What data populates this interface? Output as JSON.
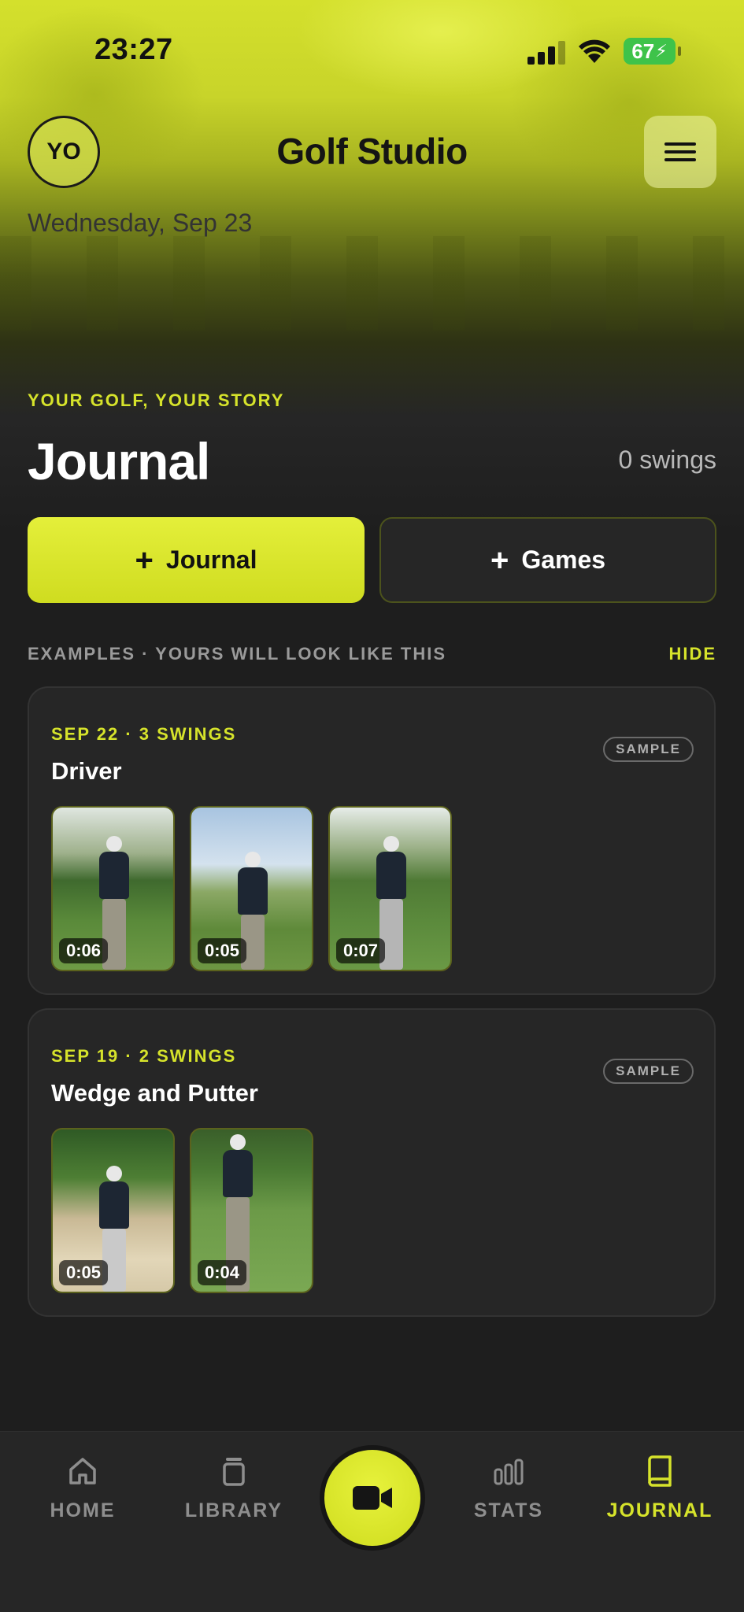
{
  "status_bar": {
    "time": "23:27",
    "battery": "67"
  },
  "header": {
    "avatar_initials": "YO",
    "app_title": "Golf Studio",
    "date": "Wednesday, Sep 23"
  },
  "hero": {
    "eyebrow": "YOUR GOLF, YOUR STORY",
    "title": "Journal",
    "swing_count": "0 swings"
  },
  "actions": {
    "journal_label": "Journal",
    "games_label": "Games"
  },
  "examples": {
    "label": "EXAMPLES · YOURS WILL LOOK LIKE THIS",
    "hide_label": "HIDE"
  },
  "entries": [
    {
      "meta": "SEP 22 · 3 SWINGS",
      "title": "Driver",
      "badge": "SAMPLE",
      "clips": [
        {
          "duration": "0:06"
        },
        {
          "duration": "0:05"
        },
        {
          "duration": "0:07"
        }
      ]
    },
    {
      "meta": "SEP 19 · 2 SWINGS",
      "title": "Wedge and Putter",
      "badge": "SAMPLE",
      "clips": [
        {
          "duration": "0:05"
        },
        {
          "duration": "0:04"
        }
      ]
    }
  ],
  "tabs": {
    "home": "HOME",
    "library": "LIBRARY",
    "stats": "STATS",
    "journal": "JOURNAL"
  },
  "colors": {
    "accent": "#d6e32b",
    "background": "#1e1e1e",
    "card": "#262626"
  }
}
